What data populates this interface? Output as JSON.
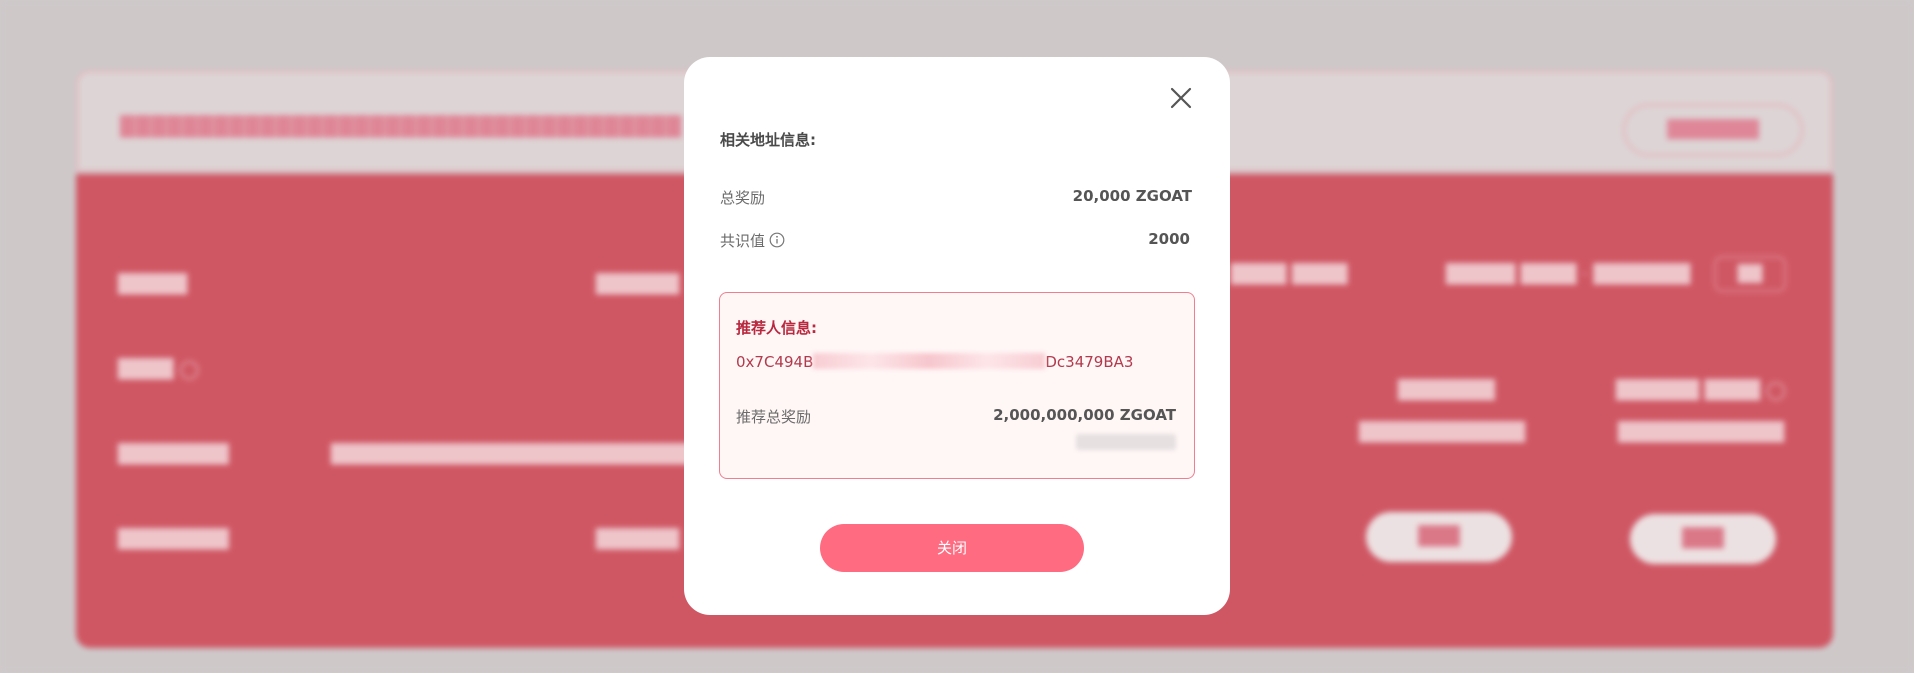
{
  "modal": {
    "heading": "相关地址信息:",
    "total_reward_label": "总奖励",
    "total_reward_value": "20,000 ZGOAT",
    "consensus_label": "共识值",
    "consensus_value": "2000",
    "referrer": {
      "heading": "推荐人信息:",
      "address_prefix": "0x7C494B",
      "address_suffix": "Dc3479BA3",
      "total_label": "推荐总奖励",
      "total_value": "2,000,000,000 ZGOAT"
    },
    "close_button_label": "关闭"
  },
  "icons": {
    "close": "close-icon",
    "info": "info-icon"
  },
  "colors": {
    "accent": "#ff6b80",
    "referrer_border": "#ef7f8e",
    "referrer_text": "#b8283e",
    "background_panel": "#d45966"
  }
}
